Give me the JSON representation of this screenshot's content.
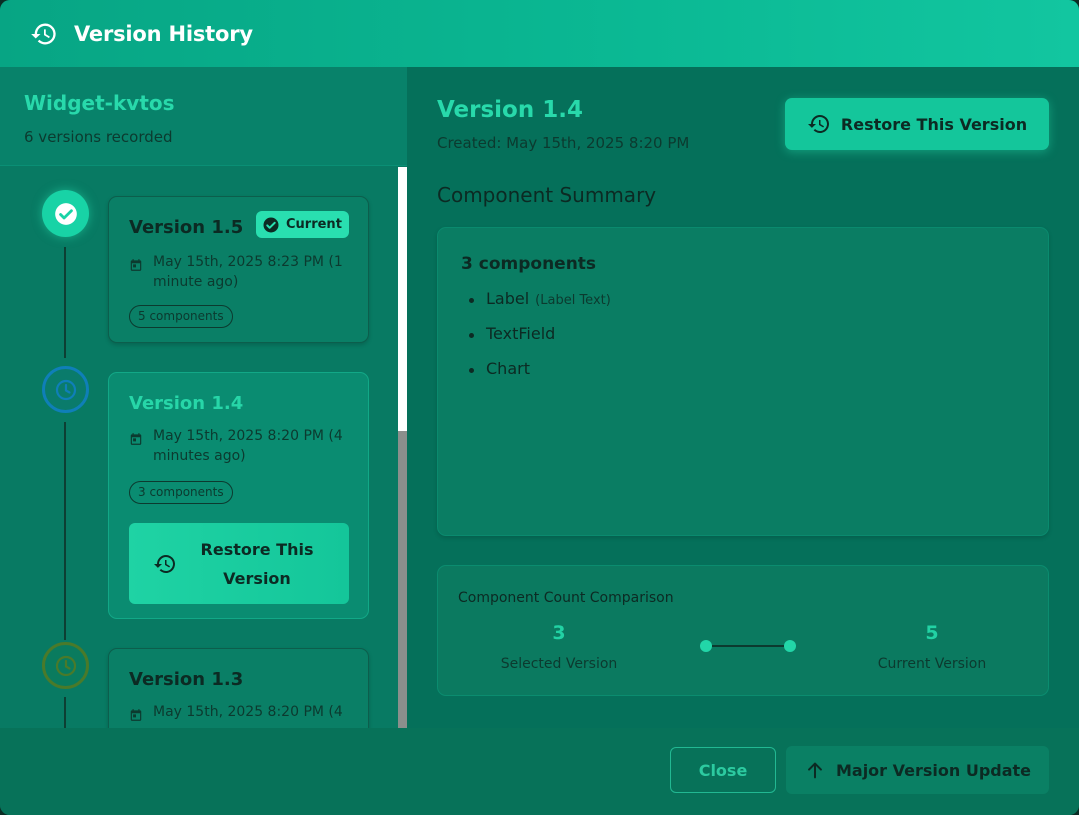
{
  "header": {
    "title": "Version History",
    "icon": "history-icon"
  },
  "sidebar": {
    "project_name": "Widget-kvtos",
    "version_count": "6 versions recorded",
    "versions": [
      {
        "label": "Version 1.5",
        "date": "May 15th, 2025 8:23 PM (1 minute ago)",
        "components": "5 components",
        "badge": "Current",
        "state": "current"
      },
      {
        "label": "Version 1.4",
        "date": "May 15th, 2025 8:20 PM (4 minutes ago)",
        "components": "3 components",
        "restore_label": "Restore This Version",
        "state": "selected"
      },
      {
        "label": "Version 1.3",
        "date": "May 15th, 2025 8:20 PM (4",
        "state": "past"
      }
    ]
  },
  "detail": {
    "version": "Version 1.4",
    "created": "Created: May 15th, 2025 8:20 PM",
    "restore_label": "Restore This Version",
    "summary_title": "Component Summary",
    "component_count": "3 components",
    "components": [
      {
        "name": "Label",
        "sub": "(Label Text)"
      },
      {
        "name": "TextField",
        "sub": ""
      },
      {
        "name": "Chart",
        "sub": ""
      }
    ],
    "comparison": {
      "title": "Component Count Comparison",
      "selected_value": "3",
      "selected_label": "Selected Version",
      "current_value": "5",
      "current_label": "Current Version"
    }
  },
  "footer": {
    "close_label": "Close",
    "major_label": "Major Version Update"
  },
  "colors": {
    "accent": "#28d9ab",
    "header": "#0bb994",
    "panel": "#05705a"
  }
}
